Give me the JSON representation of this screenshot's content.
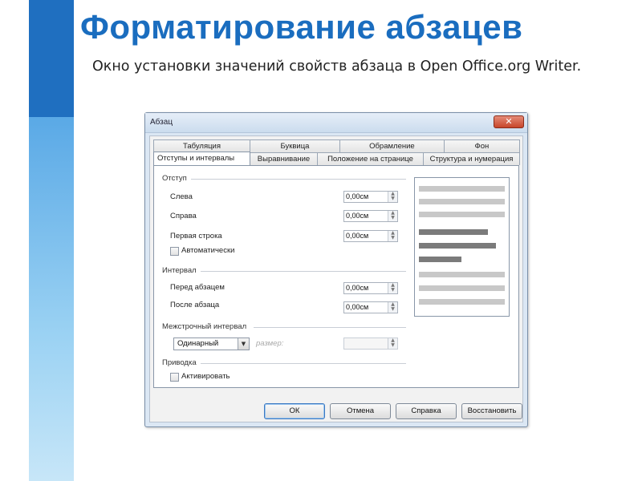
{
  "slide": {
    "title": "Форматирование абзацев",
    "subtitle": "Окно установки значений свойств абзаца в Open Office.org Writer."
  },
  "dialog": {
    "title": "Абзац",
    "close_icon": "close-icon",
    "tabs_row1": [
      "Табуляция",
      "Буквица",
      "Обрамление",
      "Фон"
    ],
    "tabs_row2": [
      "Отступы и интервалы",
      "Выравнивание",
      "Положение на странице",
      "Структура и нумерация"
    ],
    "active_tab": "Отступы и интервалы",
    "indent": {
      "heading": "Отступ",
      "left_label": "Слева",
      "left_value": "0,00см",
      "right_label": "Справа",
      "right_value": "0,00см",
      "first_line_label": "Первая строка",
      "first_line_value": "0,00см",
      "auto_label": "Автоматически"
    },
    "spacing": {
      "heading": "Интервал",
      "before_label": "Перед абзацем",
      "before_value": "0,00см",
      "after_label": "После абзаца",
      "after_value": "0,00см"
    },
    "line_spacing": {
      "heading": "Межстрочный интервал",
      "selected": "Одинарный",
      "size_label": "размер:"
    },
    "register": {
      "heading": "Приводка",
      "activate_label": "Активировать"
    },
    "buttons": {
      "ok": "ОК",
      "cancel": "Отмена",
      "help": "Справка",
      "reset": "Восстановить"
    },
    "colors": {
      "accent": "#1a6dbf",
      "preview_light": "#c8c8c8",
      "preview_dark": "#7b7b7b"
    }
  }
}
